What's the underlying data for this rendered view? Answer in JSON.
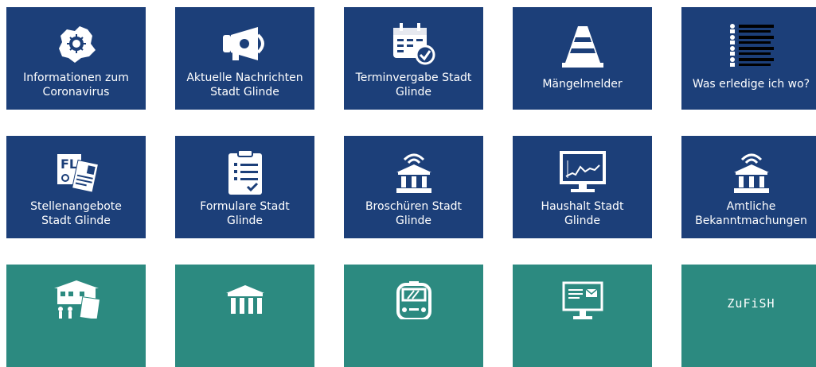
{
  "tiles": [
    {
      "label": "Informationen zum\nCoronavirus",
      "icon": "virus-map-icon"
    },
    {
      "label": "Aktuelle Nachrichten\nStadt Glinde",
      "icon": "megaphone-icon"
    },
    {
      "label": "Terminvergabe Stadt\nGlinde",
      "icon": "calendar-check-icon"
    },
    {
      "label": "Mängelmelder",
      "icon": "traffic-cone-icon"
    },
    {
      "label": "Was erledige ich wo?",
      "icon": "people-list-icon"
    },
    {
      "label": "Stellenangebote\nStadt Glinde",
      "icon": "job-documents-icon"
    },
    {
      "label": "Formulare Stadt\nGlinde",
      "icon": "clipboard-form-icon"
    },
    {
      "label": "Broschüren Stadt\nGlinde",
      "icon": "broadcast-building-icon"
    },
    {
      "label": "Haushalt Stadt\nGlinde",
      "icon": "monitor-chart-icon"
    },
    {
      "label": "Amtliche\nBekanntmachungen",
      "icon": "broadcast-building-icon"
    },
    {
      "label": "",
      "icon": "school-children-icon"
    },
    {
      "label": "",
      "icon": "museum-icon"
    },
    {
      "label": "",
      "icon": "bus-icon"
    },
    {
      "label": "",
      "icon": "email-screen-icon"
    },
    {
      "label": "ZuFiSH",
      "icon": ""
    }
  ],
  "colors": {
    "blue": "#1c3f79",
    "teal": "#2c8a80"
  }
}
